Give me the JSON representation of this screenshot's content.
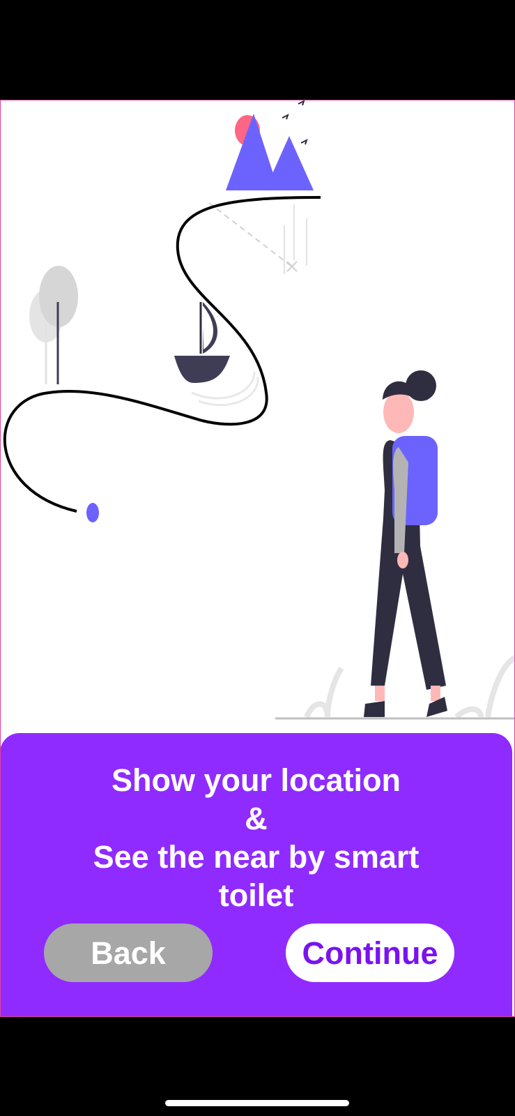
{
  "onboarding": {
    "message_lines": [
      "Show your location",
      "&",
      "See the near by smart",
      "toilet"
    ],
    "back_label": "Back",
    "continue_label": "Continue"
  },
  "colors": {
    "accent": "#8f2bff",
    "continue_text": "#7a12f0",
    "back_button": "#a7a7a7",
    "illustration_primary": "#6c63ff",
    "illustration_dark": "#2f2e41"
  },
  "icons": [
    "mountain-illustration",
    "boat-illustration",
    "woman-with-backpack-illustration",
    "tree-illustration",
    "location-pin-icon"
  ]
}
